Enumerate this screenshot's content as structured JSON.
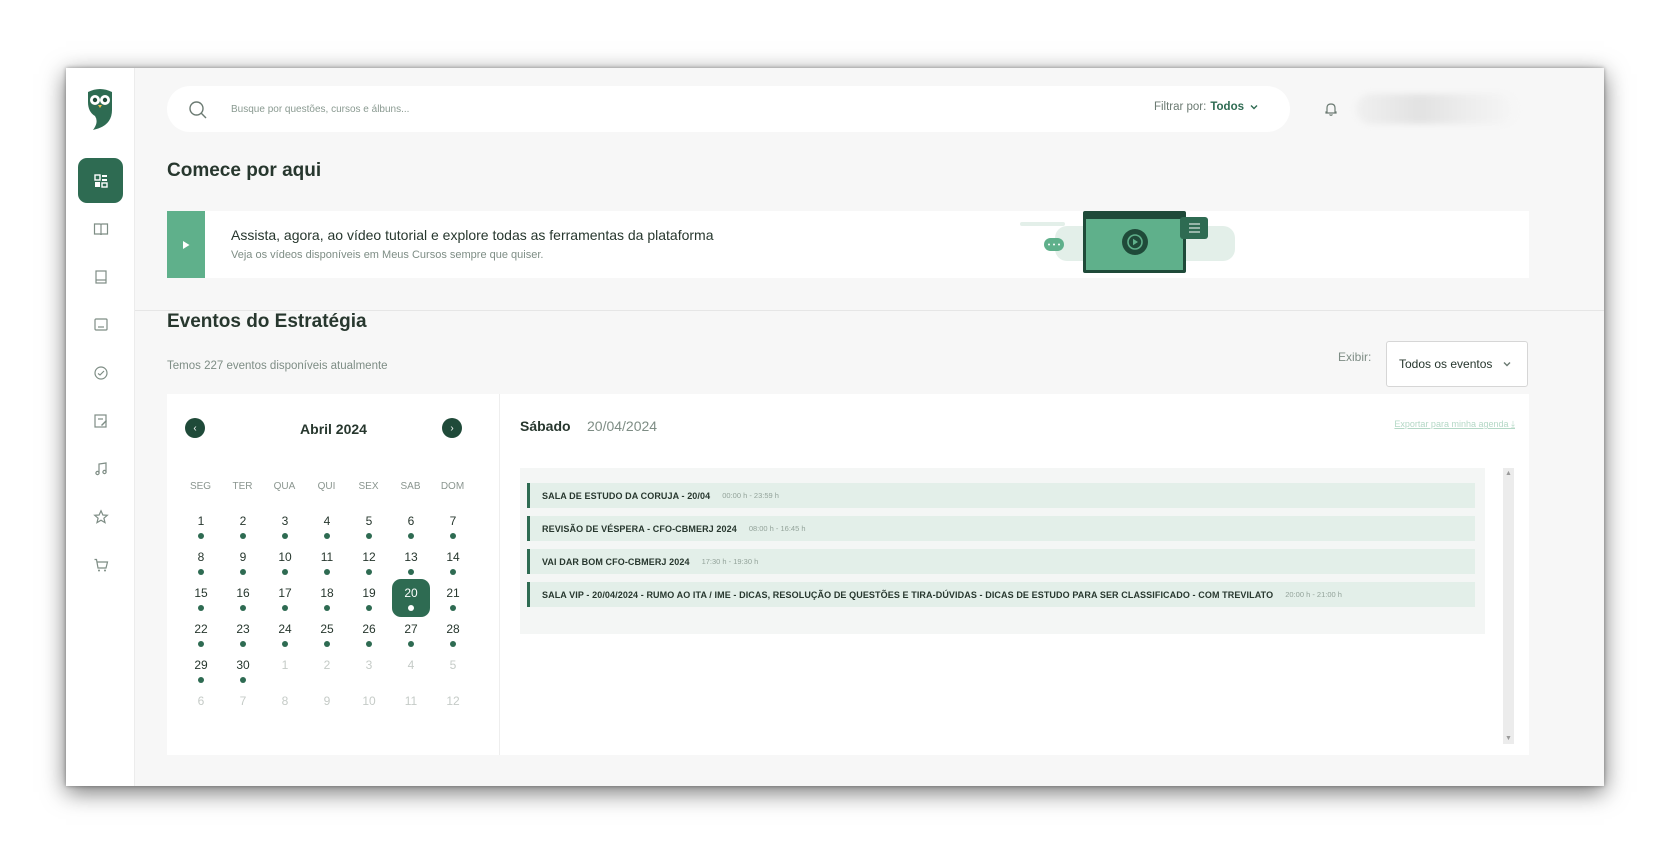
{
  "header": {
    "search_placeholder": "Busque por questões, cursos e álbuns...",
    "filter_label": "Filtrar por:",
    "filter_value": "Todos"
  },
  "sidebar": {
    "items": [
      "dashboard-icon",
      "book-open-icon",
      "book-icon",
      "monitor-icon",
      "clock-check-icon",
      "edit-list-icon",
      "music-icon",
      "star-icon",
      "cart-icon"
    ]
  },
  "intro": {
    "title": "Comece por aqui",
    "banner_title": "Assista, agora, ao vídeo tutorial e explore todas as ferramentas da plataforma",
    "banner_subtitle": "Veja os vídeos disponíveis em Meus Cursos sempre que quiser."
  },
  "events": {
    "title": "Eventos do Estratégia",
    "subtitle": "Temos 227 eventos disponíveis atualmente",
    "show_label": "Exibir:",
    "show_value": "Todos os eventos"
  },
  "calendar": {
    "month": "Abril 2024",
    "weekdays": [
      "SEG",
      "TER",
      "QUA",
      "QUI",
      "SEX",
      "SAB",
      "DOM"
    ],
    "days": [
      {
        "d": "1",
        "dot": true
      },
      {
        "d": "2",
        "dot": true
      },
      {
        "d": "3",
        "dot": true
      },
      {
        "d": "4",
        "dot": true
      },
      {
        "d": "5",
        "dot": true
      },
      {
        "d": "6",
        "dot": true
      },
      {
        "d": "7",
        "dot": true
      },
      {
        "d": "8",
        "dot": true
      },
      {
        "d": "9",
        "dot": true
      },
      {
        "d": "10",
        "dot": true
      },
      {
        "d": "11",
        "dot": true
      },
      {
        "d": "12",
        "dot": true
      },
      {
        "d": "13",
        "dot": true
      },
      {
        "d": "14",
        "dot": true
      },
      {
        "d": "15",
        "dot": true
      },
      {
        "d": "16",
        "dot": true
      },
      {
        "d": "17",
        "dot": true
      },
      {
        "d": "18",
        "dot": true
      },
      {
        "d": "19",
        "dot": true
      },
      {
        "d": "20",
        "dot": true,
        "selected": true
      },
      {
        "d": "21",
        "dot": true
      },
      {
        "d": "22",
        "dot": true
      },
      {
        "d": "23",
        "dot": true
      },
      {
        "d": "24",
        "dot": true
      },
      {
        "d": "25",
        "dot": true
      },
      {
        "d": "26",
        "dot": true
      },
      {
        "d": "27",
        "dot": true
      },
      {
        "d": "28",
        "dot": true
      },
      {
        "d": "29",
        "dot": true
      },
      {
        "d": "30",
        "dot": true
      },
      {
        "d": "1",
        "muted": true
      },
      {
        "d": "2",
        "muted": true
      },
      {
        "d": "3",
        "muted": true
      },
      {
        "d": "4",
        "muted": true
      },
      {
        "d": "5",
        "muted": true
      },
      {
        "d": "6",
        "muted": true
      },
      {
        "d": "7",
        "muted": true
      },
      {
        "d": "8",
        "muted": true
      },
      {
        "d": "9",
        "muted": true
      },
      {
        "d": "10",
        "muted": true
      },
      {
        "d": "11",
        "muted": true
      },
      {
        "d": "12",
        "muted": true
      }
    ]
  },
  "agenda": {
    "day_name": "Sábado",
    "date": "20/04/2024",
    "export_label": "Exportar para minha agenda",
    "items": [
      {
        "title": "SALA DE ESTUDO DA CORUJA - 20/04",
        "time": "00:00 h - 23:59 h"
      },
      {
        "title": "REVISÃO DE VÉSPERA - CFO-CBMERJ 2024",
        "time": "08:00 h - 16:45 h"
      },
      {
        "title": "VAI DAR BOM CFO-CBMERJ 2024",
        "time": "17:30 h - 19:30 h"
      },
      {
        "title": "SALA VIP - 20/04/2024 - RUMO AO ITA / IME - DICAS, RESOLUÇÃO DE QUESTÕES E TIRA-DÚVIDAS - DICAS DE ESTUDO PARA SER CLASSIFICADO - COM TREVILATO",
        "time": "20:00 h - 21:00 h"
      }
    ]
  },
  "colors": {
    "brand": "#2e6b52",
    "accent_light": "#5fb08b"
  }
}
